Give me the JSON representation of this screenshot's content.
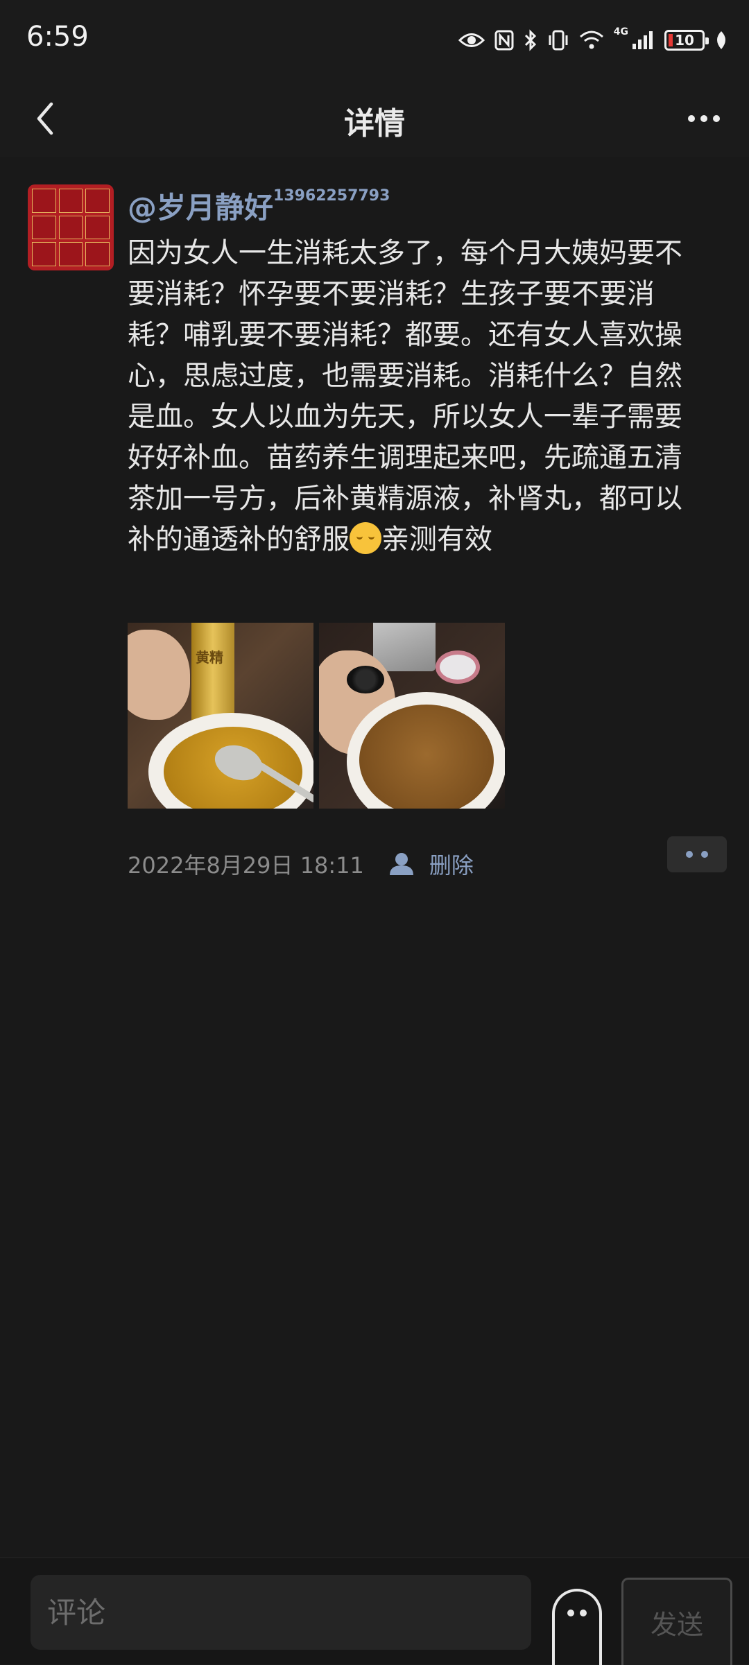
{
  "status_bar": {
    "time": "6:59",
    "network": "4G",
    "battery": "10"
  },
  "nav": {
    "title": "详情"
  },
  "post": {
    "username": "@岁月静好",
    "username_suffix": "13962257793",
    "text_main": "因为女人一生消耗太多了，每个月大姨妈要不要消耗？怀孕要不要消耗？生孩子要不要消耗？哺乳要不要消耗？都要。还有女人喜欢操心，思虑过度，也需要消耗。消耗什么？自然是血。女人以血为先天，所以女人一辈子需要好好补血。苗药养生调理起来吧，先疏通五清茶加一号方，后补黄精源液，补肾丸，都可以补的通透补的舒服",
    "text_tail": "亲测有效",
    "emoji": "relieved-face",
    "photo_label": "黄精",
    "timestamp": "2022年8月29日 18:11",
    "delete_label": "删除"
  },
  "comment_bar": {
    "placeholder": "评论",
    "send_label": "发送"
  },
  "colors": {
    "background": "#191919",
    "link_blue": "#8aa0c3",
    "text": "#e7e7e7",
    "avatar_red": "#b21e23"
  }
}
